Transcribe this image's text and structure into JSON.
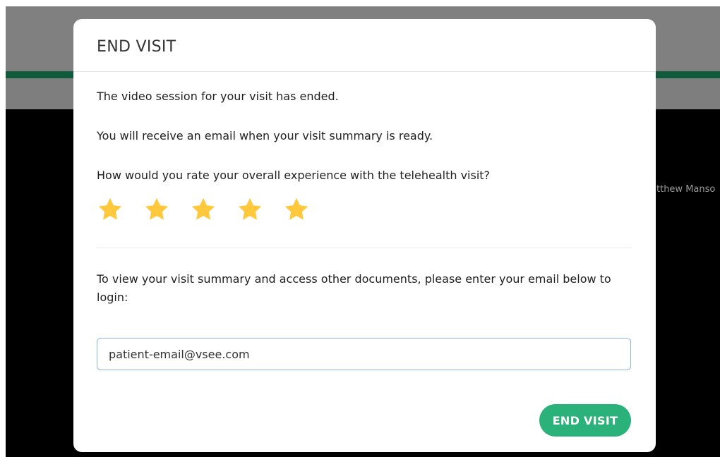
{
  "background": {
    "participant_name_partial": "tthew Manso"
  },
  "modal": {
    "title": "END VISIT",
    "session_ended_text": "The video session for your visit has ended.",
    "email_notice_text": "You will receive an email when your visit summary is ready.",
    "rating_question": "How would you rate your overall experience with the telehealth visit?",
    "rating": {
      "value": 5,
      "max": 5,
      "star_color": "#FFC83D"
    },
    "login_prompt": "To view your visit summary and access other documents, please enter your email below to login:",
    "email_input": {
      "value": "patient-email@vsee.com"
    },
    "end_visit_button_label": "END VISIT"
  },
  "colors": {
    "accent_green": "#2BB17A",
    "header_stripe": "#0F5B3C",
    "input_focus_border": "#8AB4E6"
  }
}
